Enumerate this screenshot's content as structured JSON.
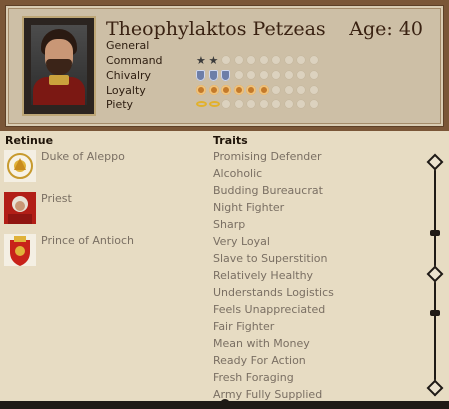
{
  "character": {
    "name": "Theophylaktos Petzeas",
    "age_text": "Age: 40",
    "rank": "General"
  },
  "stats": {
    "command": {
      "label": "Command",
      "value": 2,
      "max": 10,
      "icon": "star-icon"
    },
    "chivalry": {
      "label": "Chivalry",
      "value": 3,
      "max": 10,
      "icon": "shield-icon"
    },
    "loyalty": {
      "label": "Loyalty",
      "value": 6,
      "max": 10,
      "icon": "loyalty-icon"
    },
    "piety": {
      "label": "Piety",
      "value": 2,
      "max": 10,
      "icon": "halo-icon"
    }
  },
  "retinue": {
    "title": "Retinue",
    "items": [
      {
        "label": "Duke of Aleppo",
        "icon": "duke-icon"
      },
      {
        "label": "Priest",
        "icon": "priest-icon"
      },
      {
        "label": "Prince of Antioch",
        "icon": "prince-crest-icon"
      }
    ]
  },
  "traits": {
    "title": "Traits",
    "items": [
      "Promising Defender",
      "Alcoholic",
      "Budding Bureaucrat",
      "Night Fighter",
      "Sharp",
      "Very Loyal",
      "Slave to Superstition",
      "Relatively Healthy",
      "Understands Logistics",
      "Feels Unappreciated",
      "Fair Fighter",
      "Mean with Money",
      "Ready For Action",
      "Fresh Foraging",
      "Army Fully Supplied"
    ]
  },
  "colors": {
    "frame": "#7a5637",
    "panel": "#cdbfa6",
    "background": "#e7dcc3",
    "trait_text": "#7a6f63",
    "heading": "#3a2212"
  }
}
